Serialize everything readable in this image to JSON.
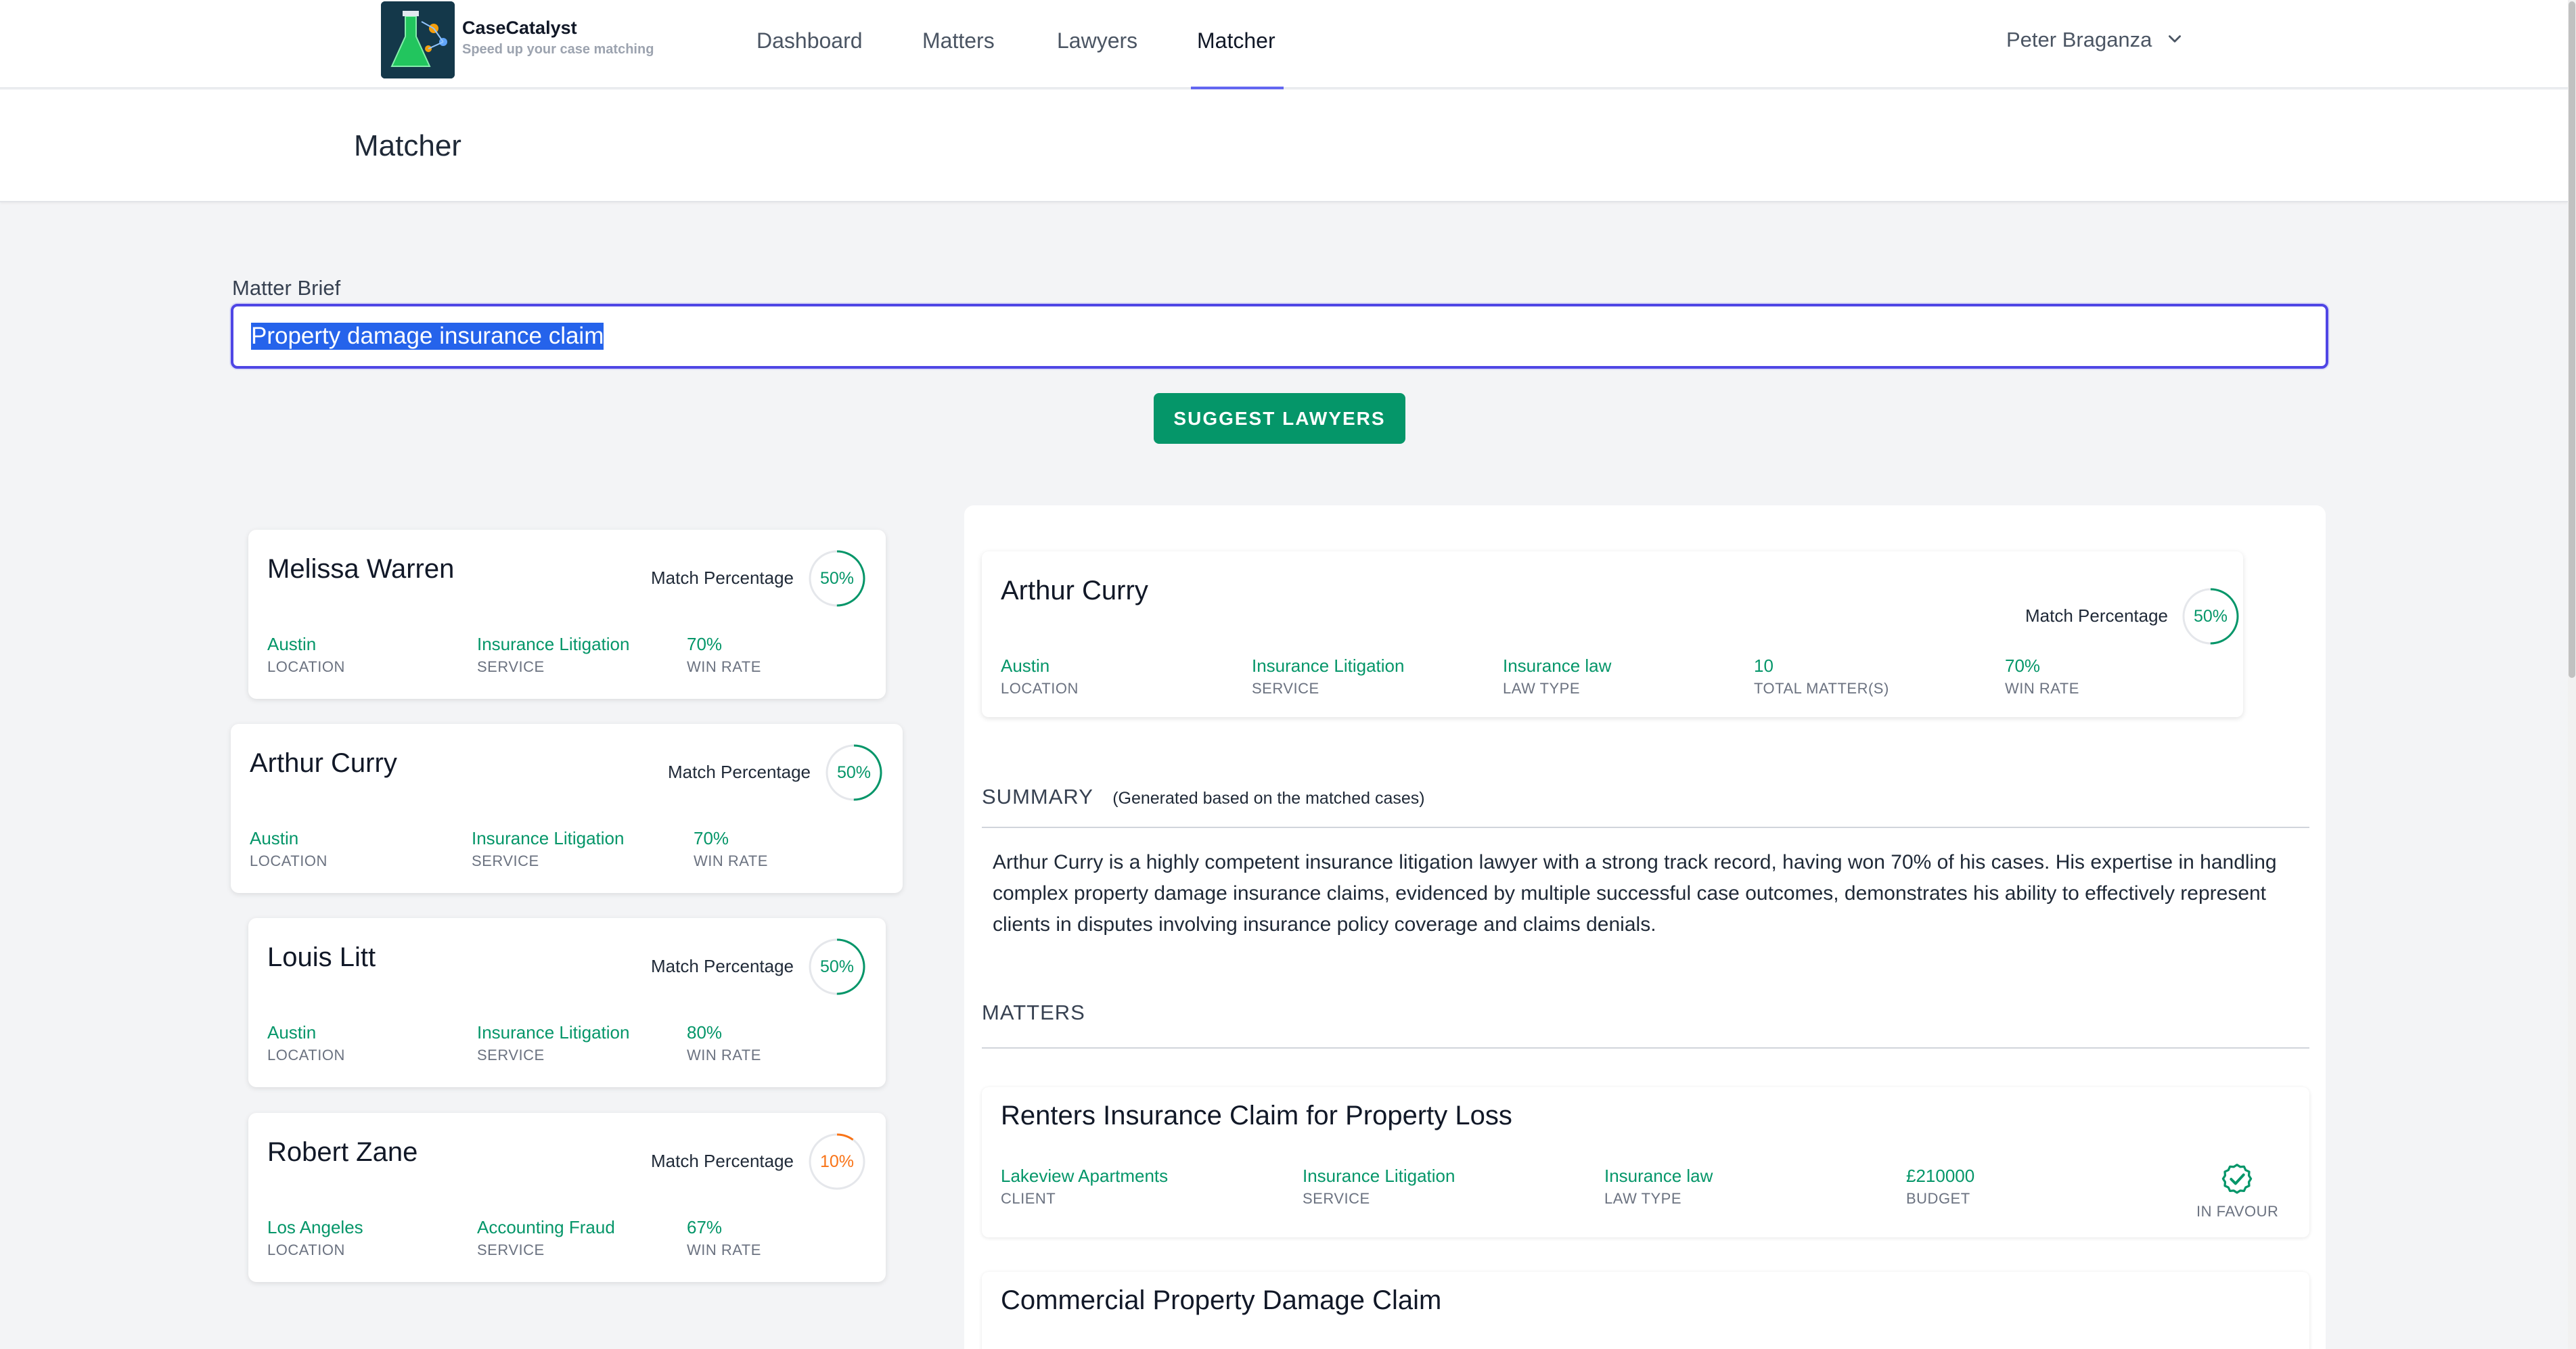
{
  "brand": {
    "name": "CaseCatalyst",
    "tagline": "Speed up your case matching"
  },
  "nav": [
    "Dashboard",
    "Matters",
    "Lawyers",
    "Matcher"
  ],
  "user": {
    "name": "Peter Braganza"
  },
  "page": {
    "title": "Matcher"
  },
  "form": {
    "label": "Matter Brief",
    "value": "Property damage insurance claim",
    "button": "SUGGEST LAWYERS"
  },
  "labels": {
    "match_percentage": "Match Percentage",
    "location": "LOCATION",
    "service": "SERVICE",
    "win_rate": "WIN RATE",
    "law_type": "LAW TYPE",
    "total_matters": "TOTAL MATTER(S)",
    "client": "CLIENT",
    "budget": "BUDGET",
    "in_favour": "IN FAVOUR"
  },
  "lawyers": [
    {
      "name": "Melissa Warren",
      "match": "50%",
      "match_value": 50,
      "location": "Austin",
      "service": "Insurance Litigation",
      "win_rate": "70%"
    },
    {
      "name": "Arthur Curry",
      "match": "50%",
      "match_value": 50,
      "location": "Austin",
      "service": "Insurance Litigation",
      "win_rate": "70%"
    },
    {
      "name": "Louis Litt",
      "match": "50%",
      "match_value": 50,
      "location": "Austin",
      "service": "Insurance Litigation",
      "win_rate": "80%"
    },
    {
      "name": "Robert Zane",
      "match": "10%",
      "match_value": 10,
      "location": "Los Angeles",
      "service": "Accounting Fraud",
      "win_rate": "67%"
    }
  ],
  "detail": {
    "name": "Arthur Curry",
    "match": "50%",
    "match_value": 50,
    "location": "Austin",
    "service": "Insurance Litigation",
    "law_type": "Insurance law",
    "total_matters": "10",
    "win_rate": "70%",
    "summary_heading": "SUMMARY",
    "summary_note": "(Generated based on the matched cases)",
    "summary": "Arthur Curry is a highly competent insurance litigation lawyer with a strong track record, having won 70% of his cases. His expertise in handling complex property damage insurance claims, evidenced by multiple successful case outcomes, demonstrates his ability to effectively represent clients in disputes involving insurance policy coverage and claims denials.",
    "matters_heading": "MATTERS",
    "matters": [
      {
        "title": "Renters Insurance Claim for Property Loss",
        "client": "Lakeview Apartments",
        "service": "Insurance Litigation",
        "law_type": "Insurance law",
        "budget": "£210000"
      },
      {
        "title": "Commercial Property Damage Claim"
      }
    ]
  },
  "colors": {
    "accent": "#059669",
    "primary": "#4f46e5",
    "warning": "#f97316",
    "nav_active": "#6366f1"
  }
}
